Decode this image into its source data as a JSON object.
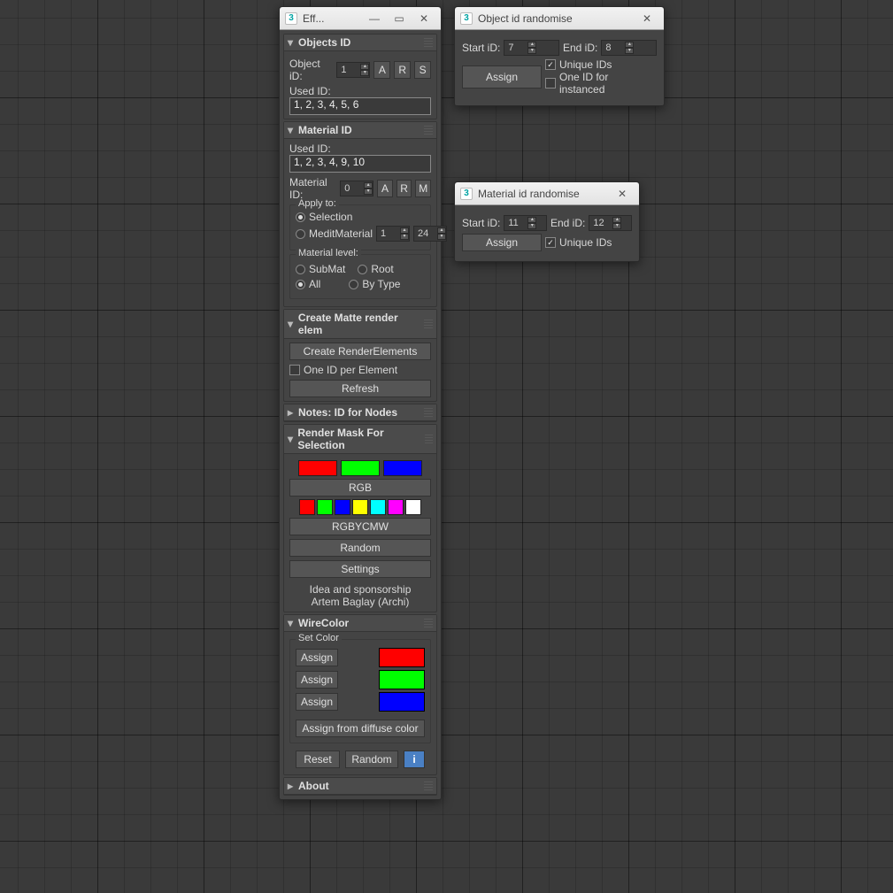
{
  "main": {
    "title": "Eff...",
    "objects_id": {
      "header": "Objects ID",
      "object_id_label": "Object iD:",
      "object_id_value": "1",
      "btn_a": "A",
      "btn_r": "R",
      "btn_s": "S",
      "used_id_label": "Used ID:",
      "used_id_value": "1, 2, 3, 4, 5, 6"
    },
    "material_id": {
      "header": "Material ID",
      "used_id_label": "Used ID:",
      "used_id_value": "1, 2, 3, 4, 9, 10",
      "material_id_label": "Material ID:",
      "material_id_value": "0",
      "btn_a": "A",
      "btn_r": "R",
      "btn_m": "M",
      "apply_to": {
        "title": "Apply to:",
        "selection": "Selection",
        "medit": "MeditMaterial",
        "medit_val1": "1",
        "medit_val2": "24"
      },
      "material_level": {
        "title": "Material level:",
        "submat": "SubMat",
        "root": "Root",
        "all": "All",
        "bytype": "By Type"
      }
    },
    "matte": {
      "header": "Create Matte render elem",
      "create": "Create RenderElements",
      "one_id": "One ID per Element",
      "refresh": "Refresh"
    },
    "notes": {
      "header": "Notes: ID for Nodes"
    },
    "rendermask": {
      "header": "Render Mask For Selection",
      "rgb_btn": "RGB",
      "rgbycmw_btn": "RGBYCMW",
      "random_btn": "Random",
      "settings_btn": "Settings",
      "credit1": "Idea and sponsorship",
      "credit2": "Artem Baglay (Archi)",
      "colors_rgb": [
        "#ff0000",
        "#00ff00",
        "#0000ff"
      ],
      "colors_7": [
        "#ff0000",
        "#00ff00",
        "#0000ff",
        "#ffff00",
        "#00ffff",
        "#ff00ff",
        "#ffffff"
      ]
    },
    "wirecolor": {
      "header": "WireColor",
      "setcolor_title": "Set Color",
      "assign": "Assign",
      "colors": [
        "#ff0000",
        "#00ff00",
        "#0000ff"
      ],
      "assign_diffuse": "Assign from diffuse color",
      "reset": "Reset",
      "random": "Random",
      "info": "i"
    },
    "about": {
      "header": "About"
    }
  },
  "obj_rand": {
    "title": "Object id randomise",
    "start_label": "Start iD:",
    "start_val": "7",
    "end_label": "End iD:",
    "end_val": "8",
    "assign": "Assign",
    "unique": "Unique IDs",
    "one_instanced": "One ID for instanced"
  },
  "mat_rand": {
    "title": "Material id randomise",
    "start_label": "Start iD:",
    "start_val": "11",
    "end_label": "End iD:",
    "end_val": "12",
    "assign": "Assign",
    "unique": "Unique IDs"
  }
}
